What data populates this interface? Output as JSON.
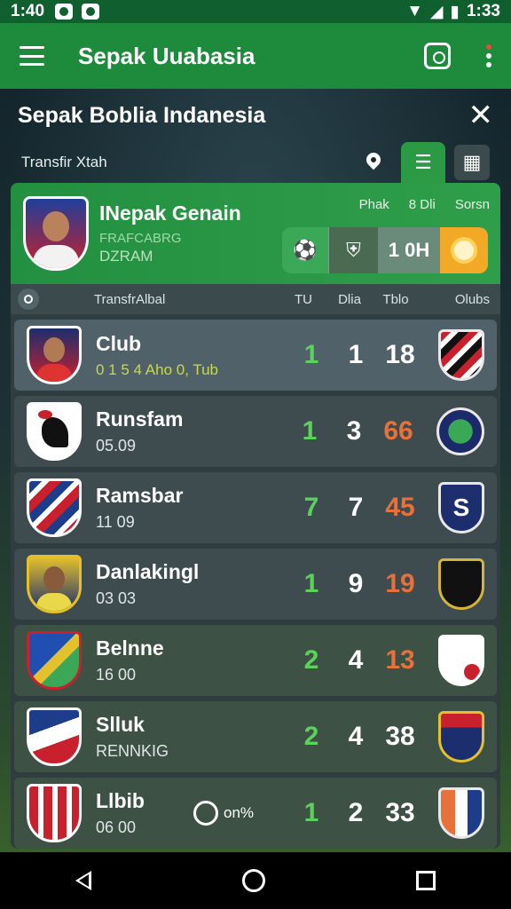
{
  "status": {
    "time_left": "1:40",
    "time_right": "1:33"
  },
  "app_bar": {
    "title": "Sepak Uuabasia"
  },
  "sheet": {
    "title": "Sepak Boblia Indanesia"
  },
  "filter": {
    "label": "Transfir Xtah"
  },
  "featured": {
    "name": "INepak Genain",
    "sub1": "FRAFCABRG",
    "sub2": "DZRAM",
    "cols": [
      "Phak",
      "8  Dli",
      "Sorsn"
    ],
    "strip_value": "1 0H"
  },
  "columns": {
    "transfer": "TransfrAlbal",
    "c1": "TU",
    "c2": "Dlia",
    "c3": "Tblo",
    "club": "Olubs"
  },
  "rows": [
    {
      "name": "Club",
      "sub": "0 1 5 4  Aho   0,  Tub",
      "a": "1",
      "b": "1",
      "c": "18"
    },
    {
      "name": "Runsfam",
      "sub": "05.09",
      "a": "1",
      "b": "3",
      "c": "66"
    },
    {
      "name": "Ramsbar",
      "sub": "11 09",
      "a": "7",
      "b": "7",
      "c": "45"
    },
    {
      "name": "Danlakingl",
      "sub": "03 03",
      "a": "1",
      "b": "9",
      "c": "19"
    },
    {
      "name": "Belnne",
      "sub": "16 00",
      "a": "2",
      "b": "4",
      "c": "13"
    },
    {
      "name": "Slluk",
      "sub": "RENNKIG",
      "a": "2",
      "b": "4",
      "c": "38"
    },
    {
      "name": "Llbib",
      "sub": "06 00",
      "extra": "on%",
      "a": "1",
      "b": "2",
      "c": "33"
    }
  ],
  "colors": {
    "app_bar": "#1d8a3c",
    "accent_green": "#5bd35a",
    "accent_orange": "#e8703a"
  }
}
